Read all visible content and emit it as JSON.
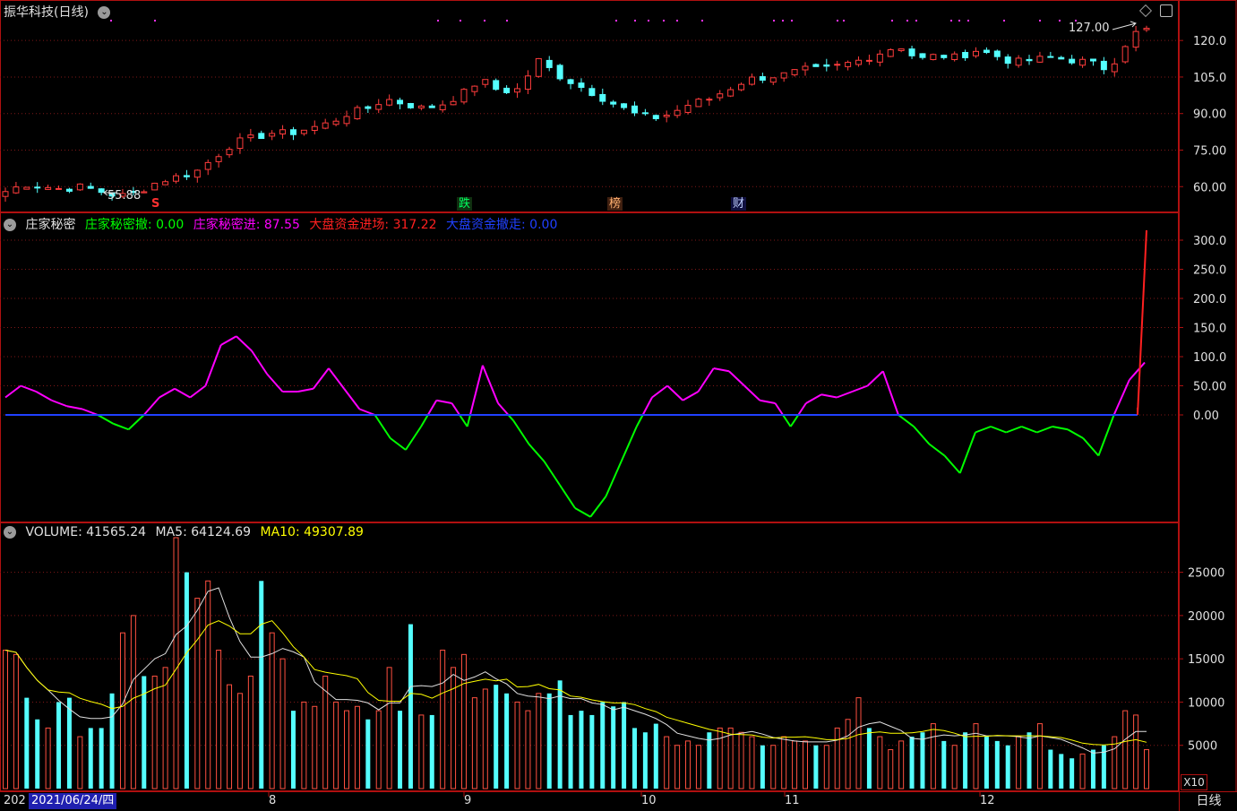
{
  "top_panel": {
    "title": "振华科技(日线)",
    "high_label": "127.00",
    "low_label": "55.88",
    "events": [
      {
        "label": "S",
        "color": "#ff3030",
        "bg": "none"
      },
      {
        "label": "跌",
        "color": "#00ff60",
        "bg": "#103010"
      },
      {
        "label": "榜",
        "color": "#ffb070",
        "bg": "#402010"
      },
      {
        "label": "财",
        "color": "#c0d0ff",
        "bg": "#101040"
      }
    ]
  },
  "indicator_panel": {
    "name": "庄家秘密",
    "items": [
      {
        "label": "庄家秘密撤: 0.00",
        "color": "#00ff00"
      },
      {
        "label": "庄家秘密进: 87.55",
        "color": "#ff00ff"
      },
      {
        "label": "大盘资金进场: 317.22",
        "color": "#ff2020"
      },
      {
        "label": "大盘资金撤走: 0.00",
        "color": "#2040ff"
      }
    ]
  },
  "volume_panel": {
    "items": [
      {
        "label": "VOLUME: 41565.24",
        "color": "#e0e0e0"
      },
      {
        "label": "MA5: 64124.69",
        "color": "#e0e0e0"
      },
      {
        "label": "MA10: 49307.89",
        "color": "#ffff00"
      }
    ]
  },
  "x_axis": {
    "start_label": "202",
    "date_label": "2021/06/24/四",
    "months": [
      "8",
      "9",
      "10",
      "11",
      "12"
    ]
  },
  "x10_label": "X10",
  "timeframe_label": "日线",
  "chart_data": [
    {
      "type": "candlestick",
      "title": "振华科技(日线)",
      "ylim": [
        52,
        130
      ],
      "yticks": [
        "60.00",
        "75.00",
        "90.00",
        "105.0",
        "120.0"
      ],
      "ytick_values": [
        60,
        75,
        90,
        105,
        120
      ],
      "close_anchor": [
        58,
        61,
        60,
        59,
        60,
        58,
        56,
        58,
        62,
        64,
        66,
        72,
        78,
        80,
        82,
        82,
        84,
        86,
        90,
        92,
        96,
        94,
        92,
        94,
        98,
        104,
        99,
        100,
        112,
        106,
        102,
        98,
        94,
        90,
        88,
        90,
        94,
        96,
        100,
        104,
        105,
        106,
        108,
        108,
        110,
        112,
        115,
        118,
        112,
        114,
        113,
        116,
        114,
        111,
        112,
        113,
        112,
        111,
        108,
        120,
        127
      ]
    },
    {
      "type": "line",
      "title": "庄家秘密",
      "ylim": [
        -180,
        320
      ],
      "yticks": [
        "0.00",
        "50.00",
        "100.0",
        "150.0",
        "200.0",
        "250.0",
        "300.0"
      ],
      "ytick_values": [
        0,
        50,
        100,
        150,
        200,
        250,
        300
      ],
      "series": [
        {
          "name": "庄家秘密进",
          "color": "#ff00ff",
          "values": [
            30,
            50,
            40,
            25,
            15,
            10,
            0,
            -15,
            -25,
            0,
            30,
            45,
            30,
            50,
            120,
            135,
            110,
            70,
            40,
            40,
            45,
            80,
            45,
            10,
            0,
            -40,
            -60,
            -20,
            25,
            20,
            -20,
            85,
            20,
            -10,
            -50,
            -80,
            -120,
            -160,
            -175,
            -140,
            -80,
            -20,
            30,
            50,
            25,
            40,
            80,
            75,
            50,
            25,
            20,
            -20,
            20,
            35,
            30,
            40,
            50,
            75,
            0,
            -20,
            -50,
            -70,
            -100,
            -30,
            -20,
            -30,
            -20,
            -30,
            -20,
            -25,
            -40,
            -70,
            0,
            60,
            90
          ]
        },
        {
          "name": "大盘资金进场",
          "color": "#ff2020",
          "values": [
            0,
            317
          ]
        }
      ]
    },
    {
      "type": "bar",
      "title": "VOLUME",
      "ylim": [
        0,
        29000
      ],
      "yticks": [
        "5000",
        "10000",
        "15000",
        "20000",
        "25000"
      ],
      "ytick_values": [
        5000,
        10000,
        15000,
        20000,
        25000
      ],
      "values": [
        16000,
        15500,
        10500,
        8000,
        7000,
        10000,
        10500,
        6000,
        7000,
        7000,
        11000,
        18000,
        20000,
        13000,
        13000,
        14000,
        29000,
        25000,
        22000,
        24000,
        16000,
        12000,
        11000,
        13000,
        24000,
        18000,
        15000,
        9000,
        10000,
        9500,
        13000,
        10000,
        9000,
        9500,
        8000,
        9000,
        14000,
        9000,
        19000,
        8500,
        8500,
        16000,
        14000,
        15500,
        10500,
        11500,
        12000,
        11000,
        10000,
        9000,
        11000,
        11000,
        12500,
        8500,
        9000,
        8500,
        10000,
        9500,
        10000,
        7000,
        6500,
        7500,
        6000,
        5000,
        5500,
        5000,
        6500,
        7000,
        7000,
        6500,
        6000,
        5000,
        5000,
        6000,
        5500,
        5500,
        5000,
        5000,
        7000,
        8000,
        10500,
        7000,
        6000,
        4500,
        5500,
        6000,
        6500,
        7500,
        5500,
        5000,
        6500,
        7500,
        6000,
        5500,
        5000,
        6000,
        6500,
        7500,
        4500,
        4000,
        3500,
        4000,
        4500,
        5000,
        6000,
        9000,
        8500,
        4500
      ]
    }
  ]
}
